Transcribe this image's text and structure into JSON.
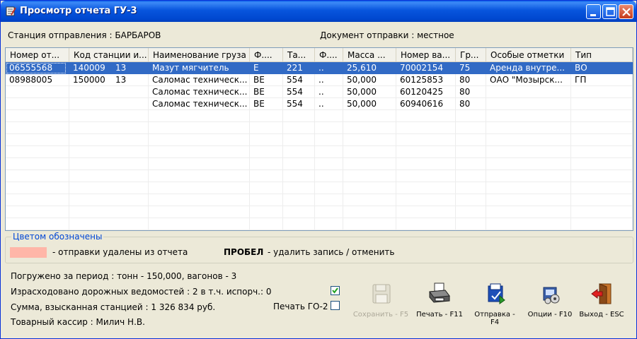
{
  "window": {
    "title": "Просмотр отчета ГУ-3"
  },
  "header": {
    "station": "Станция отправления : БАРБАРОВ",
    "document": "Документ отправки : местное"
  },
  "grid": {
    "columns": [
      "Номер от...",
      "Код станции и...",
      "Наименование груза",
      "Ф....",
      "Та...",
      "Ф....",
      "Масса ...",
      "Номер ва...",
      "Гр...",
      "Особые отметки",
      "Тип"
    ],
    "rows": [
      [
        "06555568",
        "140009",
        "13",
        "Мазут мягчитель",
        "Е",
        "221",
        "..",
        "25,610",
        "70002154",
        "75",
        "Аренда внутре...",
        "ВО"
      ],
      [
        "08988005",
        "150000",
        "13",
        "Саломас техническ...",
        "ВЕ",
        "554",
        "..",
        "50,000",
        "60125853",
        "80",
        "ОАО \"Мозырск...",
        "ГП"
      ],
      [
        "",
        "",
        "",
        "Саломас техническ...",
        "ВЕ",
        "554",
        "..",
        "50,000",
        "60120425",
        "80",
        "",
        ""
      ],
      [
        "",
        "",
        "",
        "Саломас техническ...",
        "ВЕ",
        "554",
        "..",
        "50,000",
        "60940616",
        "80",
        "",
        ""
      ]
    ],
    "selected_row": 0
  },
  "legend": {
    "title": "Цветом обозначены",
    "swatch_color": "#FFB6A8",
    "removed_text": "- отправки удалены из отчета",
    "key": "ПРОБЕЛ",
    "key_text": "- удалить запись / отменить"
  },
  "footer": {
    "loaded": "Погружено за период : тонн - 150,000, вагонов - 3",
    "spent": "Израсходовано дорожных ведомостей : 2 в т.ч. испорч.: 0",
    "sum": "Сумма, взысканная станцией : 1 326 834 руб.",
    "cashier": "Товарный кассир : Милич Н.В.",
    "print_go2_label": "Печать ГО-2",
    "checkbox1_checked": true,
    "checkbox2_checked": false
  },
  "toolbar": {
    "save": "Сохранить - F5",
    "print": "Печать - F11",
    "send": "Отправка - F4",
    "options": "Опции - F10",
    "exit": "Выход - ESC"
  },
  "colors": {
    "selection": "#316AC5",
    "title_bar": "#0855DD",
    "legend_title": "#0046D5"
  }
}
